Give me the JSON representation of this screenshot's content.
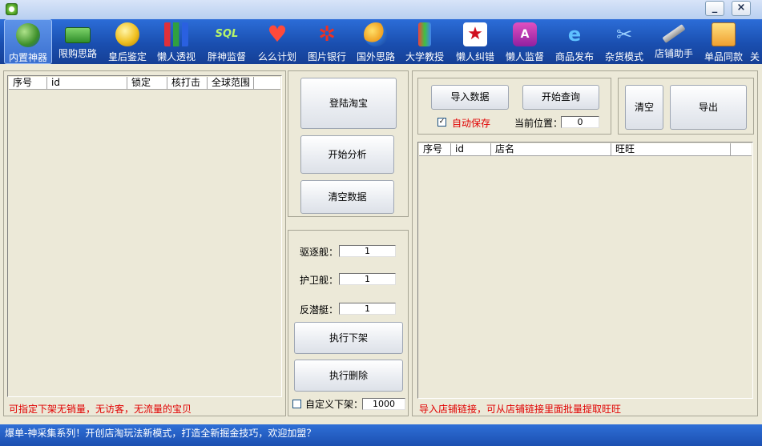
{
  "window": {
    "minimize_label": "_",
    "close_label": "×"
  },
  "toolbar": {
    "items": [
      {
        "label": "内置神器",
        "icon": "earth-vb-icon"
      },
      {
        "label": "限购思路",
        "icon": "money-bill-icon"
      },
      {
        "label": "皇后鉴定",
        "icon": "gold-coin-icon"
      },
      {
        "label": "懒人透视",
        "icon": "bar-chart-icon"
      },
      {
        "label": "胖神监督",
        "icon": "sql-icon"
      },
      {
        "label": "么么计划",
        "icon": "heart-icon"
      },
      {
        "label": "图片银行",
        "icon": "acrobat-icon"
      },
      {
        "label": "国外思路",
        "icon": "globe-icon"
      },
      {
        "label": "大学教授",
        "icon": "brushes-icon"
      },
      {
        "label": "懒人纠错",
        "icon": "star-icon"
      },
      {
        "label": "懒人监督",
        "icon": "gem-a-icon"
      },
      {
        "label": "商品发布",
        "icon": "ie-icon"
      },
      {
        "label": "杂货模式",
        "icon": "scissors-icon"
      },
      {
        "label": "店铺助手",
        "icon": "saw-icon"
      },
      {
        "label": "单品同款",
        "icon": "search-image-icon"
      },
      {
        "label": "关",
        "icon": "partial-icon"
      }
    ]
  },
  "left_panel": {
    "columns": [
      "序号",
      "id",
      "锁定",
      "核打击",
      "全球范围"
    ],
    "hint": "可指定下架无销量，无访客，无流量的宝贝"
  },
  "middle_panel": {
    "login_button": "登陆淘宝",
    "analyze_button": "开始分析",
    "clear_button": "清空数据",
    "destroyer_label": "驱逐舰：",
    "destroyer_value": "1",
    "frigate_label": "护卫舰：",
    "frigate_value": "1",
    "submarine_label": "反潜艇：",
    "submarine_value": "1",
    "delist_button": "执行下架",
    "delete_button": "执行删除",
    "custom_delist_label": "自定义下架：",
    "custom_delist_value": "1000"
  },
  "right_panel": {
    "import_button": "导入数据",
    "query_button": "开始查询",
    "autosave_label": "自动保存",
    "autosave_checked": "✓",
    "position_label": "当前位置：",
    "position_value": "0",
    "clear_button": "清空",
    "export_button": "导出",
    "columns": [
      "序号",
      "id",
      "店名",
      "旺旺"
    ],
    "hint": "导入店铺链接，可从店铺链接里面批量提取旺旺"
  },
  "status": {
    "text": "爆单-神采集系列！开创店淘玩法新模式，打造全新掘金技巧，欢迎加盟？"
  },
  "colors": {
    "toolbar": "#1a4fb0",
    "hint_red": "#e00000",
    "window_bg": "#ece9d8"
  }
}
